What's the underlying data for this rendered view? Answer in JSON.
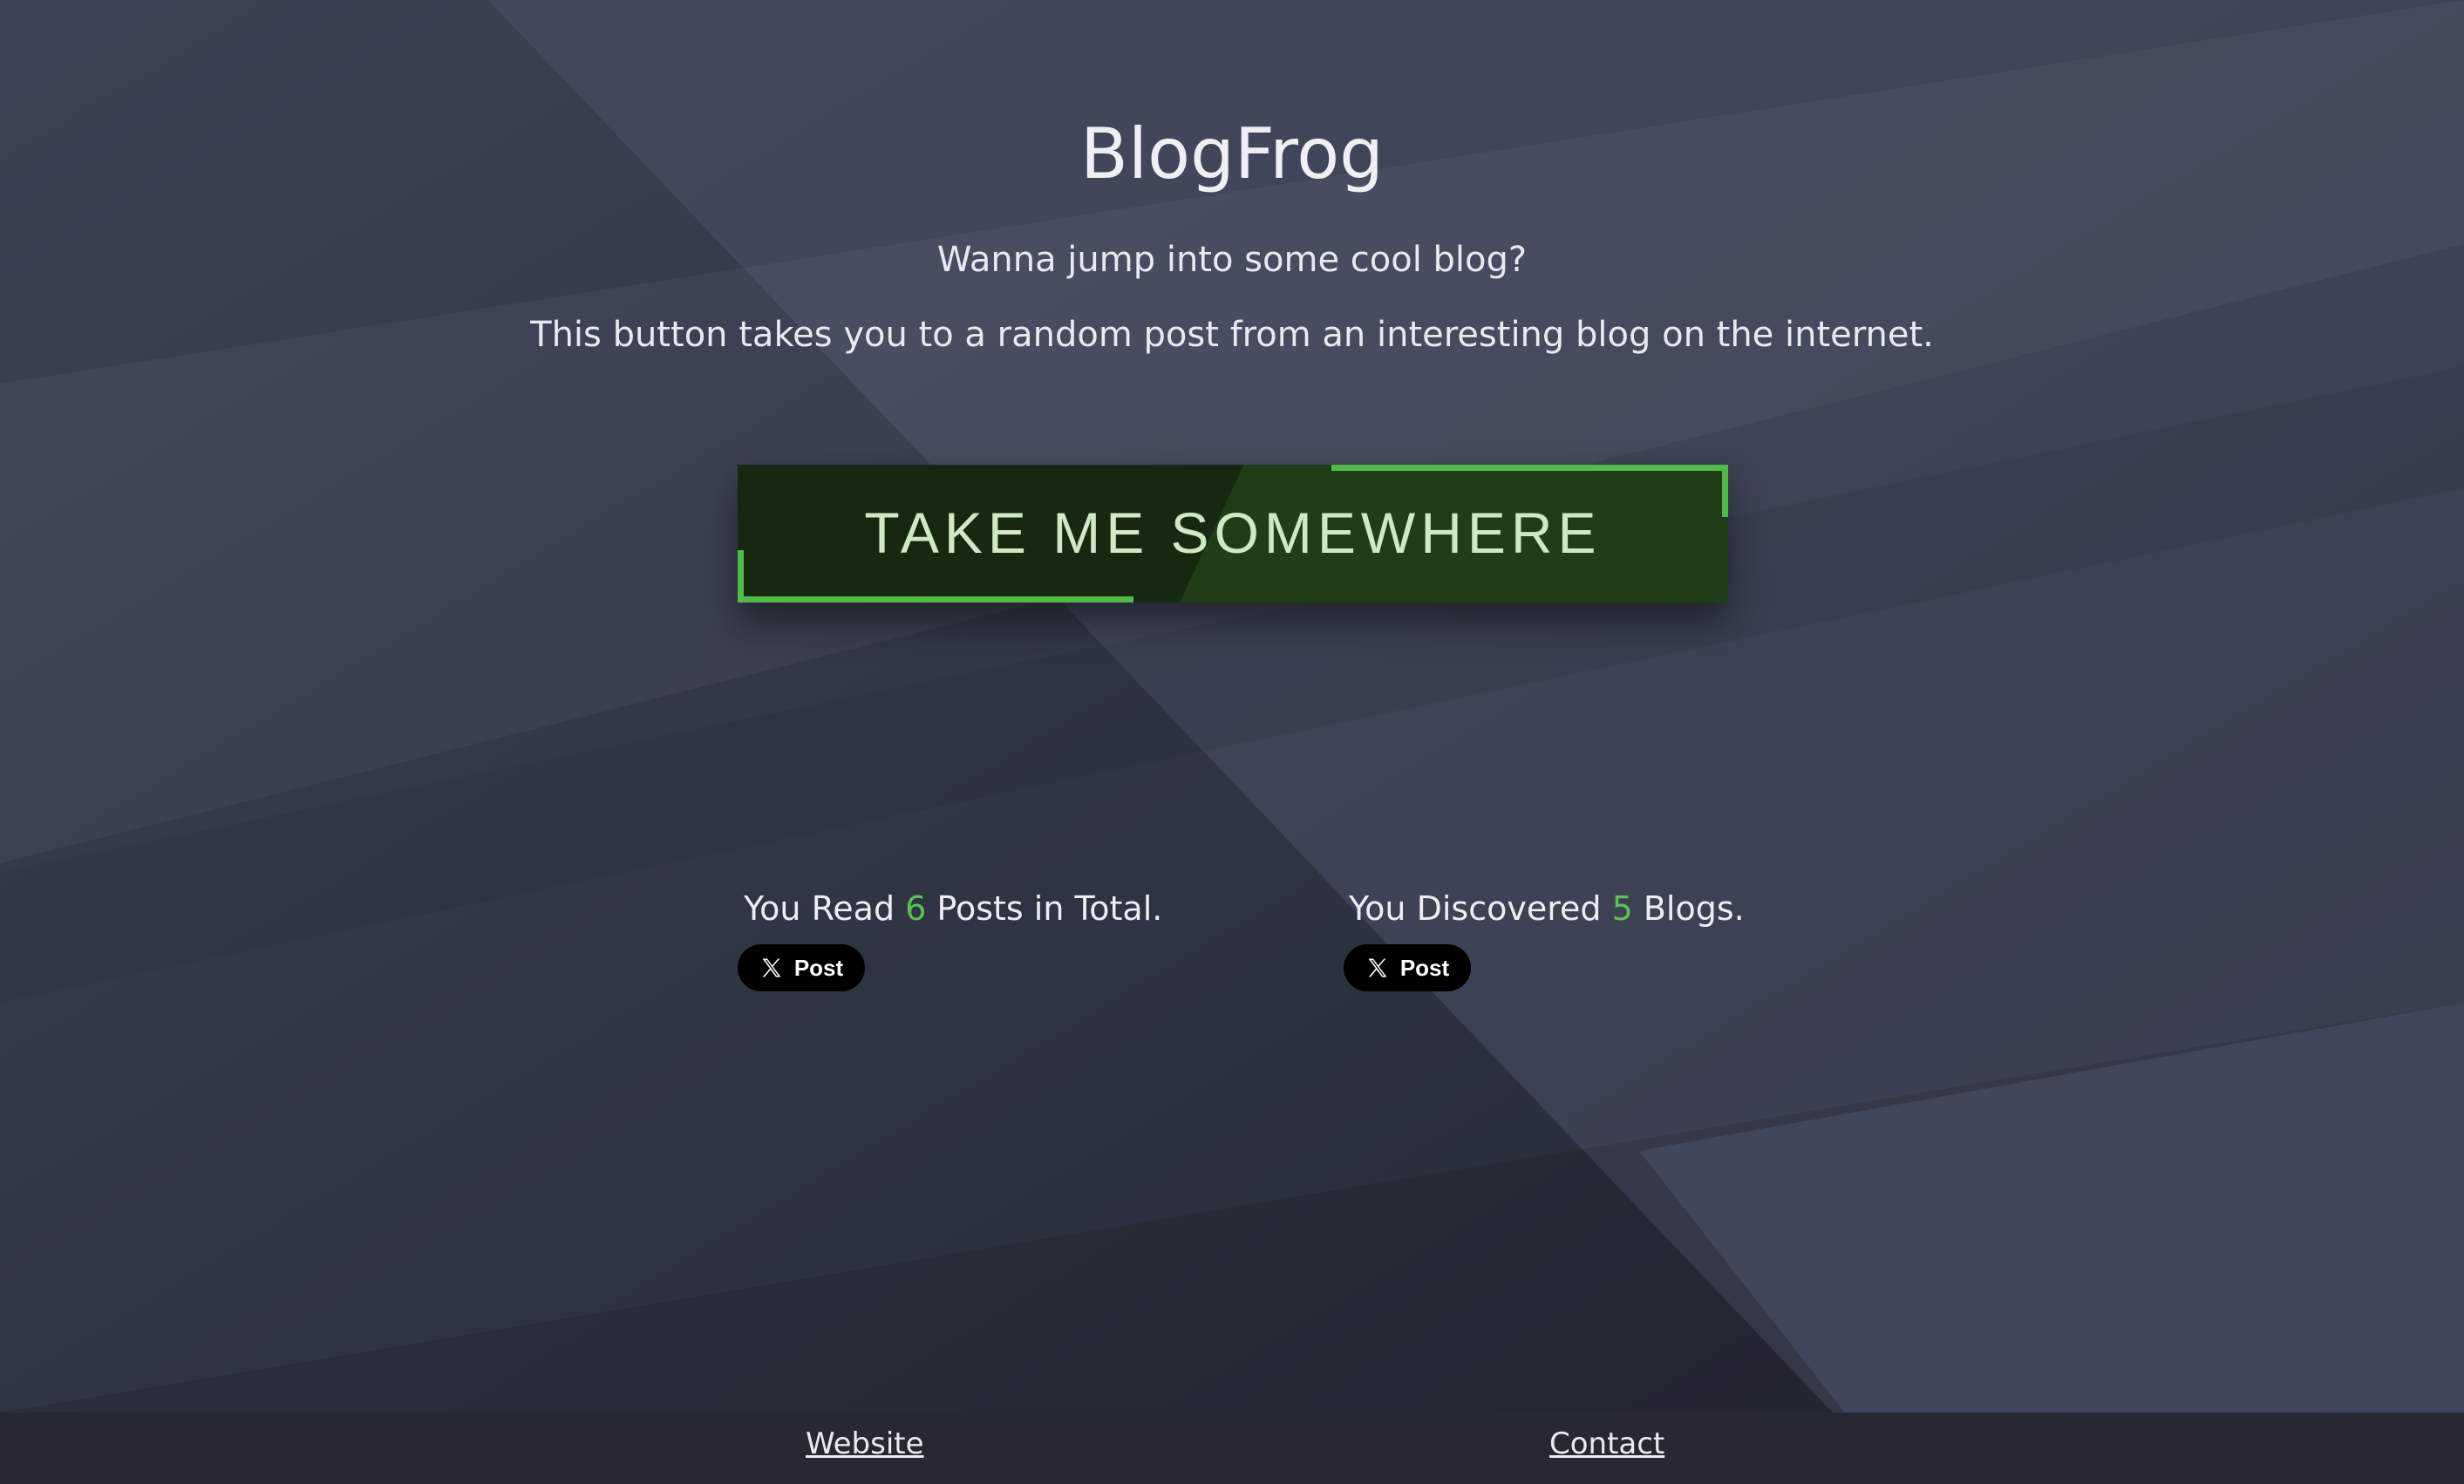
{
  "header": {
    "title": "BlogFrog",
    "tagline_1": "Wanna jump into some cool blog?",
    "tagline_2": "This button takes you to a random post from an interesting blog on the internet."
  },
  "cta": {
    "label": "TAKE ME SOMEWHERE",
    "accent_color": "#4fbc45",
    "background_color": "#1b3214"
  },
  "stats": {
    "posts": {
      "prefix": "You Read ",
      "count": "6",
      "suffix": " Posts in Total.",
      "share_label": "Post"
    },
    "blogs": {
      "prefix": "You Discovered ",
      "count": "5",
      "suffix": " Blogs.",
      "share_label": "Post"
    },
    "highlight_color": "#5cc24f",
    "share_icon": "x-logo-icon"
  },
  "footer": {
    "website_link": "Website",
    "contact_link": "Contact"
  }
}
